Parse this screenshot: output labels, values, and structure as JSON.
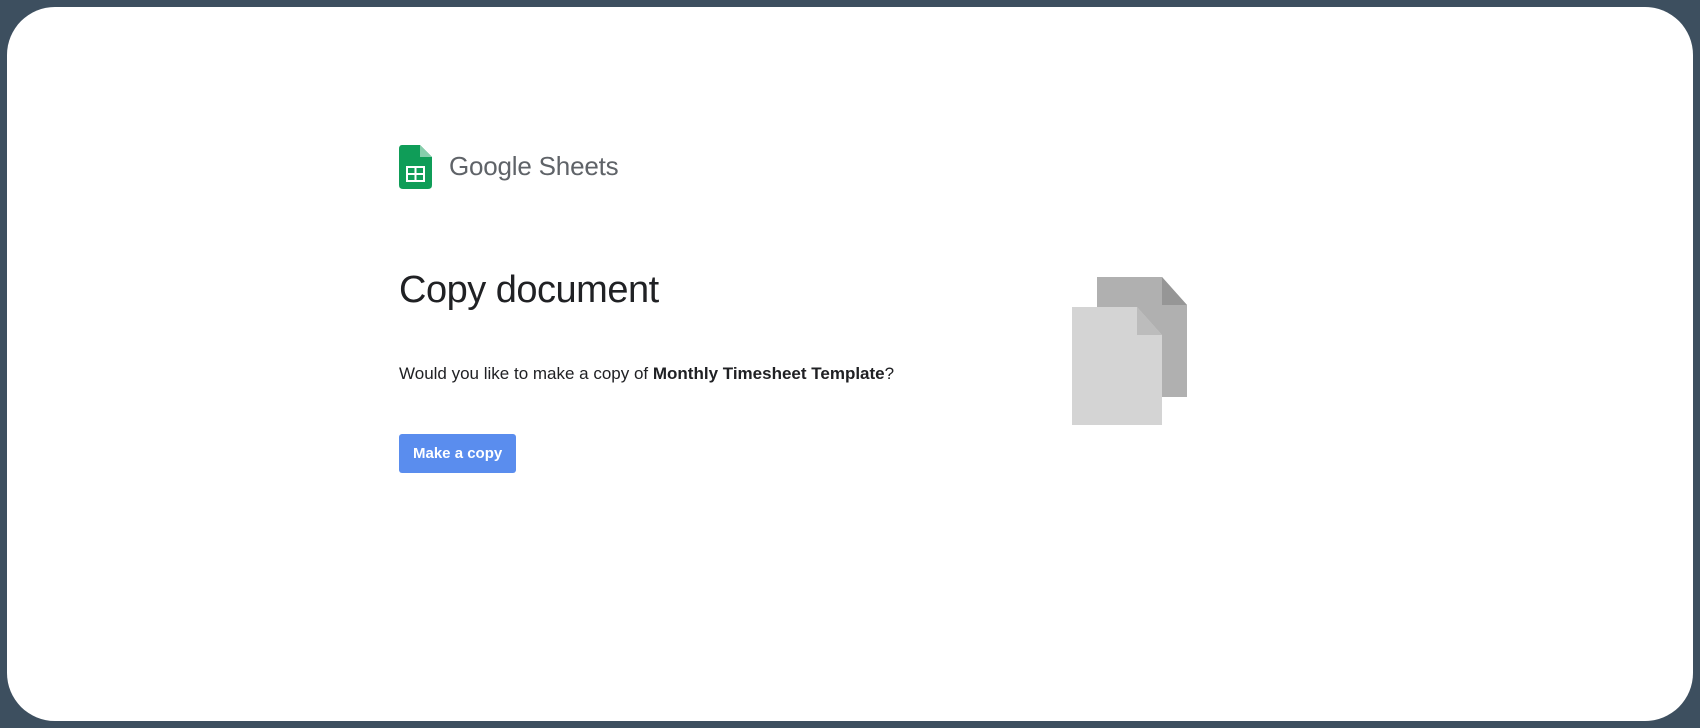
{
  "logo": {
    "product_strong": "Google",
    "product_light": " Sheets"
  },
  "title": "Copy document",
  "prompt": {
    "prefix": "Would you like to make a copy of ",
    "doc_name": "Monthly Timesheet Template",
    "suffix": "?"
  },
  "button": {
    "label": "Make a copy"
  }
}
